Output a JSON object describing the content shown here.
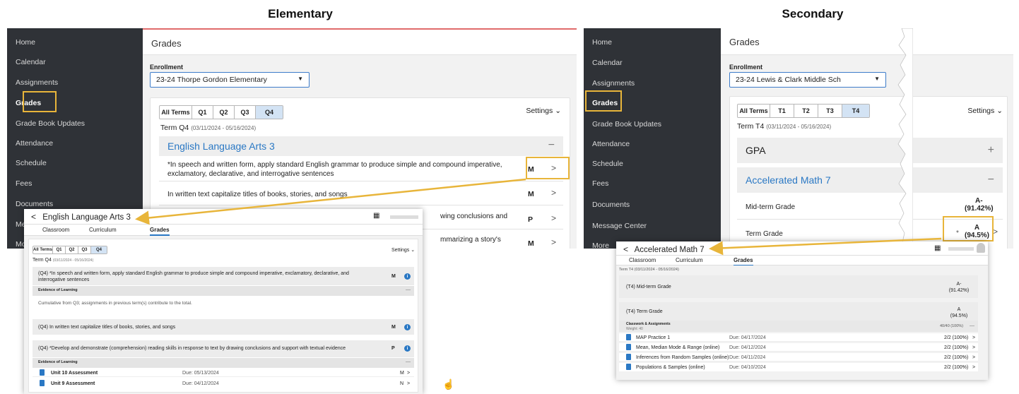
{
  "headings": {
    "left": "Elementary",
    "right": "Secondary"
  },
  "colors": {
    "sidebar": "#2f3237",
    "highlight": "#e8b53a",
    "accent": "#2a78c4",
    "tab_selected": "#d3e3f4"
  },
  "icons": [
    "back-arrow-icon",
    "calendar-icon",
    "chevron-right-icon",
    "chevron-down-icon",
    "info-icon",
    "clipboard-icon",
    "plus-icon",
    "minus-icon",
    "pointer-cursor-icon",
    "user-avatar-icon"
  ],
  "nav": {
    "items": [
      "Home",
      "Calendar",
      "Assignments",
      "Grades",
      "Grade Book Updates",
      "Attendance",
      "Schedule",
      "Fees",
      "Documents",
      "Message Center",
      "More"
    ]
  },
  "elementary": {
    "page_title": "Grades",
    "enrollment_label": "Enrollment",
    "enrollment_value": "23-24 Thorpe Gordon Elementary",
    "tabs": [
      "All Terms",
      "Q1",
      "Q2",
      "Q3",
      "Q4"
    ],
    "selected_tab": "Q4",
    "settings": "Settings",
    "term_label": "Term Q4",
    "term_dates": "(03/11/2024 - 05/16/2024)",
    "course": "English Language Arts 3",
    "standards": [
      {
        "text": "*In speech and written form, apply standard English grammar to produce simple and compound imperative, exclamatory, declarative, and interrogative sentences",
        "grade": "M"
      },
      {
        "text": "In written text capitalize titles of books, stories, and songs",
        "grade": "M"
      },
      {
        "text": "wing conclusions and",
        "grade": "P"
      },
      {
        "text": "mmarizing a story's",
        "grade": "M"
      }
    ],
    "popup": {
      "title": "English Language Arts 3",
      "tabs": [
        "Classroom",
        "Curriculum",
        "Grades"
      ],
      "active_tab": "Grades",
      "tabs_row": [
        "All Terms",
        "Q1",
        "Q2",
        "Q3",
        "Q4"
      ],
      "settings": "Settings",
      "term_label": "Term Q4",
      "term_dates": "(03/11/2024 - 05/16/2024)",
      "blocks": [
        {
          "title": "(Q4) *In speech and written form, apply standard English grammar to produce simple and compound imperative, exclamatory, declarative, and interrogative sentences",
          "grade": "M"
        },
        {
          "title": "(Q4) In written text capitalize titles of books, stories, and songs",
          "grade": "M"
        },
        {
          "title": "(Q4) *Develop and demonstrate (comprehension) reading skills in response to text by drawing conclusions and support with textual evidence",
          "grade": "P"
        }
      ],
      "evidence_label": "Evidence of Learning",
      "cumulative_note": "Cumulative from Q3; assignments in previous term(s) contribute to the total.",
      "assignments": [
        {
          "name": "Unit 10 Assessment",
          "due": "Due: 05/13/2024",
          "grade": "M"
        },
        {
          "name": "Unit 9 Assessment",
          "due": "Due: 04/12/2024",
          "grade": "N"
        }
      ]
    }
  },
  "secondary": {
    "page_title": "Grades",
    "enrollment_label": "Enrollment",
    "enrollment_value": "23-24 Lewis & Clark Middle Sch",
    "tabs": [
      "All Terms",
      "T1",
      "T2",
      "T3",
      "T4"
    ],
    "selected_tab": "T4",
    "settings": "Settings",
    "term_label": "Term T4",
    "term_dates": "(03/11/2024 - 05/16/2024)",
    "gpa_label": "GPA",
    "course": "Accelerated Math 7",
    "midterm_label": "Mid-term Grade",
    "midterm_grade": "A-",
    "midterm_pct": "(91.42%)",
    "term_grade_label": "Term Grade",
    "term_grade": "A",
    "term_pct": "(94.5%)",
    "term_grade_marker": "*",
    "popup": {
      "title": "Accelerated Math 7",
      "tabs": [
        "Classroom",
        "Curriculum",
        "Grades"
      ],
      "active_tab": "Grades",
      "term_label": "Term T4",
      "term_dates": "(03/11/2024 - 05/16/2024)",
      "midterm_label": "(T4) Mid-term Grade",
      "midterm_grade": "A-",
      "midterm_pct": "(91.42%)",
      "term_label2": "(T4) Term Grade",
      "term_grade": "A",
      "term_pct": "(94.5%)",
      "category": "Classwork & Assignments",
      "category_weight": "Weight: 40",
      "category_score": "40/40 (100%)",
      "assignments": [
        {
          "name": "MAP Practice 1",
          "due": "Due: 04/17/2024",
          "score": "2/2 (100%)"
        },
        {
          "name": "Mean, Median Mode & Range (online)",
          "due": "Due: 04/12/2024",
          "score": "2/2 (100%)"
        },
        {
          "name": "Inferences from Random Samples (online)",
          "due": "Due: 04/11/2024",
          "score": "2/2 (100%)"
        },
        {
          "name": "Populations & Samples (online)",
          "due": "Due: 04/10/2024",
          "score": "2/2 (100%)"
        }
      ]
    }
  }
}
